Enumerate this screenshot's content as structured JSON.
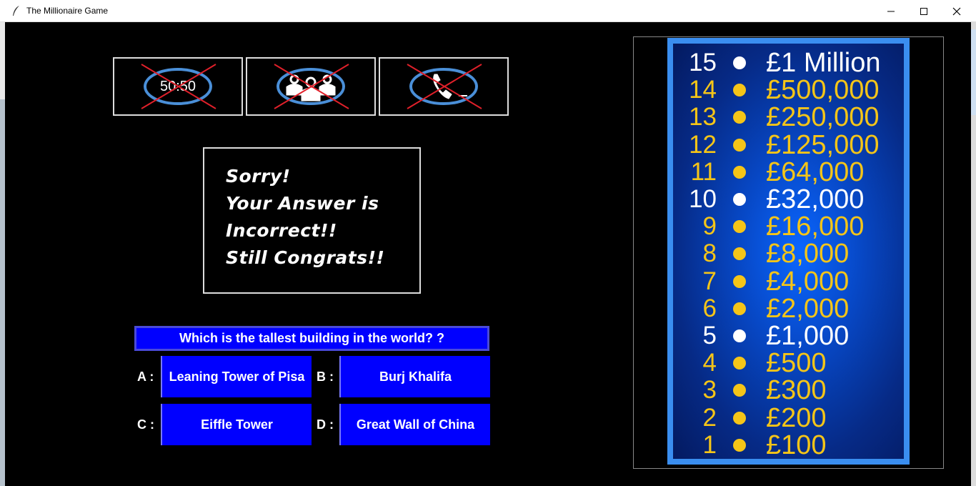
{
  "window": {
    "title": "The Millionaire Game"
  },
  "lifelines": [
    {
      "name": "50-50",
      "label": "50:50",
      "used": true
    },
    {
      "name": "ask-the-audience",
      "used": true
    },
    {
      "name": "phone-a-friend",
      "used": true
    }
  ],
  "message": {
    "line1": "Sorry!",
    "line2": "Your Answer is",
    "line3": "Incorrect!!",
    "line4": "Still Congrats!!"
  },
  "question": {
    "text": "Which is the tallest building in the world? ?",
    "options": {
      "A": {
        "prefix": "A :",
        "text": "Leaning Tower of Pisa"
      },
      "B": {
        "prefix": "B :",
        "text": "Burj Khalifa"
      },
      "C": {
        "prefix": "C :",
        "text": "Eiffle Tower"
      },
      "D": {
        "prefix": "D :",
        "text": "Great Wall of China"
      }
    }
  },
  "money_ladder": [
    {
      "level": "15",
      "amount": "£1 Million",
      "milestone": true
    },
    {
      "level": "14",
      "amount": "£500,000",
      "milestone": false
    },
    {
      "level": "13",
      "amount": "£250,000",
      "milestone": false
    },
    {
      "level": "12",
      "amount": "£125,000",
      "milestone": false
    },
    {
      "level": "11",
      "amount": "£64,000",
      "milestone": false
    },
    {
      "level": "10",
      "amount": "£32,000",
      "milestone": true
    },
    {
      "level": "9",
      "amount": "£16,000",
      "milestone": false
    },
    {
      "level": "8",
      "amount": "£8,000",
      "milestone": false
    },
    {
      "level": "7",
      "amount": "£4,000",
      "milestone": false
    },
    {
      "level": "6",
      "amount": "£2,000",
      "milestone": false
    },
    {
      "level": "5",
      "amount": "£1,000",
      "milestone": true
    },
    {
      "level": "4",
      "amount": "£500",
      "milestone": false
    },
    {
      "level": "3",
      "amount": "£300",
      "milestone": false
    },
    {
      "level": "2",
      "amount": "£200",
      "milestone": false
    },
    {
      "level": "1",
      "amount": "£100",
      "milestone": false
    }
  ],
  "colors": {
    "background": "#000000",
    "button_blue": "#0000ff",
    "ladder_gold": "#f5c518",
    "milestone_white": "#ffffff",
    "ladder_border": "#3a8ef0",
    "cross_red": "#e0202a",
    "lifeline_ring": "#4a8fd8"
  }
}
